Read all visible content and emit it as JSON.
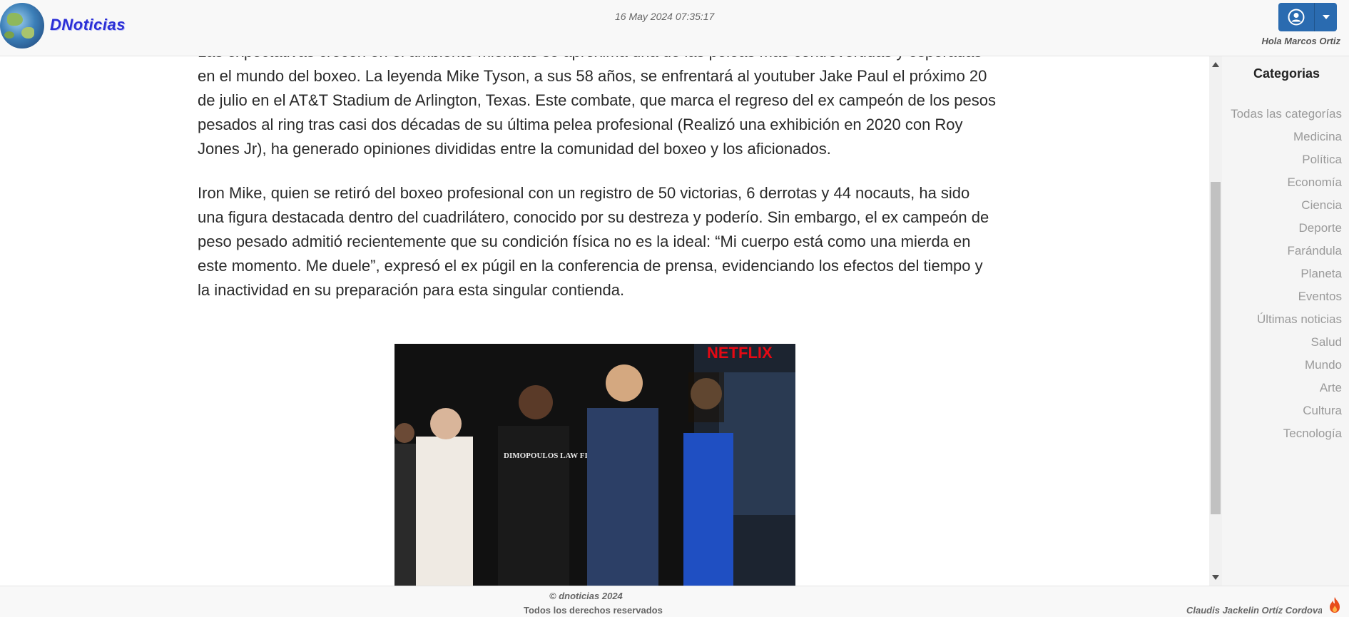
{
  "header": {
    "logo_text": "DNoticias",
    "datetime": "16 May 2024 07:35:17",
    "greeting": "Hola Marcos Ortiz"
  },
  "icons": {
    "logo": "globe-logo-icon",
    "user": "user-circle-icon",
    "dropdown": "caret-down-icon",
    "scroll_up": "arrow-up-icon",
    "scroll_down": "arrow-down-icon",
    "footer_badge": "flame-icon"
  },
  "colors": {
    "accent": "#2a6bb0",
    "logo_text": "#2b2fd6",
    "flame": "#e84d1c"
  },
  "article": {
    "paragraphs": [
      "Las expectativas crecen en el ambiente mientras se aproxima una de las peleas más controvertidas y esperadas en el mundo del boxeo. La leyenda Mike Tyson, a sus 58 años, se enfrentará al youtuber Jake Paul el próximo 20 de julio en el AT&T Stadium de Arlington, Texas. Este combate, que marca el regreso del ex campeón de los pesos pesados al ring tras casi dos décadas de su última pelea profesional (Realizó una exhibición en 2020 con Roy Jones Jr), ha generado opiniones divididas entre la comunidad del boxeo y los aficionados.",
      "Iron Mike, quien se retiró del boxeo profesional con un registro de 50 victorias, 6 derrotas y 44 nocauts, ha sido una figura destacada dentro del cuadrilátero, conocido por su destreza y poderío. Sin embargo, el ex campeón de peso pesado admitió recientemente que su condición física no es la ideal: “Mi cuerpo está como una mierda en este momento. Me duele”, expresó el ex púgil en la conferencia de prensa, evidenciando los efectos del tiempo y la inactividad en su preparación para esta singular contienda."
    ],
    "image_banner": "NETFLIX",
    "image_shirt_text": "DIMOPOULOS LAW FIRM"
  },
  "sidebar": {
    "title": "Categorias",
    "categories": [
      "Todas las categorías",
      "Medicina",
      "Política",
      "Economía",
      "Ciencia",
      "Deporte",
      "Farándula",
      "Planeta",
      "Eventos",
      "Últimas noticias",
      "Salud",
      "Mundo",
      "Arte",
      "Cultura",
      "Tecnología"
    ]
  },
  "footer": {
    "copyright": "© dnoticias 2024",
    "rights": "Todos los derechos reservados",
    "author": "Claudis Jackelin Ortíz Cordova"
  }
}
